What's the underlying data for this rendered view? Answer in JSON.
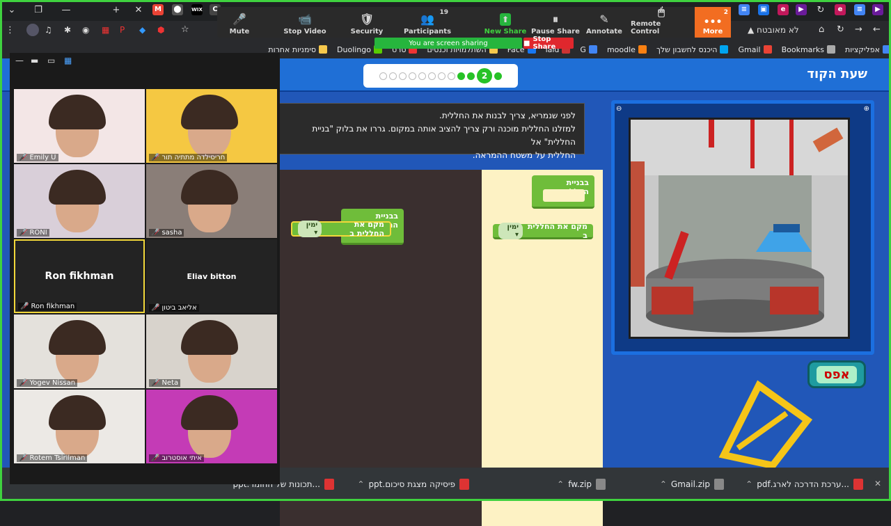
{
  "browser": {
    "bookmarks": [
      {
        "label": "אפליקציות",
        "color": "#4285f4"
      },
      {
        "label": "Bookmarks",
        "color": "#aaa"
      },
      {
        "label": "Gmail",
        "color": "#ea4335"
      },
      {
        "label": "היכנס לחשבון שלך",
        "color": "#00a4ef"
      },
      {
        "label": "moodle",
        "color": "#f98012"
      },
      {
        "label": "G",
        "color": "#4285f4"
      },
      {
        "label": "laid",
        "color": "#c33"
      },
      {
        "label": "Face",
        "color": "#1877f2"
      },
      {
        "label": "השתלמויות וכנסים",
        "color": "#f6c84c"
      },
      {
        "label": "סרט",
        "color": "#e33"
      },
      {
        "label": "Duolingo",
        "color": "#58cc02"
      },
      {
        "label": "סימניות אחרות",
        "color": "#f6c84c"
      }
    ]
  },
  "zoom": {
    "toolbar": [
      {
        "icon": "mic-icon",
        "glyph": "🎤",
        "label": "Mute"
      },
      {
        "icon": "video-icon",
        "glyph": "📹",
        "label": "Stop Video"
      },
      {
        "icon": "shield-icon",
        "glyph": "🛡",
        "label": "Security"
      },
      {
        "icon": "participants-icon",
        "glyph": "👥",
        "label": "Participants",
        "count": "19"
      },
      {
        "icon": "share-icon",
        "glyph": "⬆",
        "label": "New Share"
      },
      {
        "icon": "pause-icon",
        "glyph": "⏸",
        "label": "Pause Share"
      },
      {
        "icon": "pencil-icon",
        "glyph": "✎",
        "label": "Annotate"
      },
      {
        "icon": "mouse-icon",
        "glyph": "🖱",
        "label": "Remote Control"
      }
    ],
    "more_label": "More",
    "more_badge": "2",
    "sharing_label": "You are screen sharing",
    "stop_share_label": "Stop Share",
    "participants": [
      {
        "name": "Emily U"
      },
      {
        "name": "חריסילדה מתתיה תור"
      },
      {
        "name": "RONI"
      },
      {
        "name": "sasha"
      },
      {
        "name": "Ron fikhman",
        "big": "Ron fikhman"
      },
      {
        "name": "אליאב ביטון",
        "big": "Eliav bitton"
      },
      {
        "name": "Yogev Nissan"
      },
      {
        "name": "Neta"
      },
      {
        "name": "Rotem Tsirilman"
      },
      {
        "name": "איתי אוסטרוב"
      }
    ]
  },
  "lesson": {
    "header_title": "שעת הקוד",
    "progress_current": "2",
    "progress_total": 12,
    "progress_done": 3,
    "instructions": [
      "לפני שנמריא, צריך לבנות את החללית.",
      "למזלנו החללית מוכנה ורק צריך להציב אותה במקום. גררו את בלוק \"בניית החללית\" אל",
      "החללית על משטח ההמראה."
    ],
    "block_build": "בבניית החללית",
    "block_place": "מקם את החללית ב",
    "dropdown_value": "ימין",
    "reset_label": "אפס"
  },
  "downloads": [
    {
      "name": "...ערכת הדרכה לארג.pdf",
      "type": "pdf"
    },
    {
      "name": "Gmail.zip",
      "type": "zip"
    },
    {
      "name": "fw.zip",
      "type": "zip"
    },
    {
      "name": "פיסיקה מצגת סיכום.ppt",
      "type": "pdf"
    },
    {
      "name": "...תכונות של החומר.ppt",
      "type": "pdf"
    }
  ]
}
